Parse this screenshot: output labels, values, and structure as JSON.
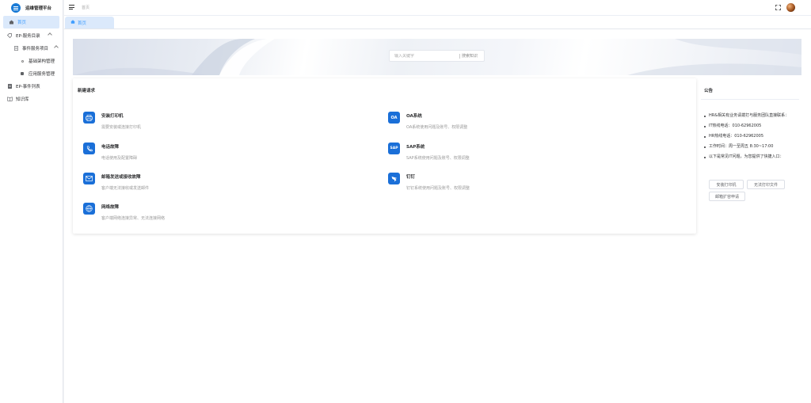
{
  "app": {
    "title": "运维管理平台"
  },
  "sidebar": {
    "items": [
      {
        "label": "首页",
        "icon": "home-icon"
      },
      {
        "label": "EP-服务目录",
        "icon": "tag-icon"
      },
      {
        "label": "事件服务项目",
        "icon": "document-icon"
      },
      {
        "label": "基础架构管理",
        "icon": "dot-icon"
      },
      {
        "label": "应用服务管理",
        "icon": "square-icon"
      },
      {
        "label": "EP-事件列表",
        "icon": "list-icon"
      },
      {
        "label": "知识库",
        "icon": "book-icon"
      }
    ]
  },
  "header": {
    "breadcrumb": "首页"
  },
  "tabs": [
    {
      "label": "首页"
    }
  ],
  "search": {
    "placeholder": "输入关键字",
    "button": "搜索知识"
  },
  "requests": {
    "title": "新建请求",
    "items": [
      {
        "name": "安装打印机",
        "desc": "需要安装或连接打印机",
        "icon": "printer-icon"
      },
      {
        "name": "OA系统",
        "desc": "OA系统使用问题及账号、权限调整",
        "icon_text": "OA"
      },
      {
        "name": "电话故障",
        "desc": "电话使用及配置障碍",
        "icon": "phone-icon"
      },
      {
        "name": "SAP系统",
        "desc": "SAP系统使用问题及账号、权限调整",
        "icon_text": "SAP"
      },
      {
        "name": "邮箱发送或接收故障",
        "desc": "客户端无法接收或发送邮件",
        "icon": "mail-icon"
      },
      {
        "name": "钉钉",
        "desc": "钉钉系统使用问题及账号、权限调整",
        "icon": "dingtalk-icon"
      },
      {
        "name": "网络故障",
        "desc": "客户端网络连接异常、无法连接网络",
        "icon": "globe-icon"
      }
    ]
  },
  "notice": {
    "title": "公告",
    "lines": [
      "HR&相关有业务请拨打与服务团队直接联系：",
      "IT热线电话：010-62962005",
      "HR热线电话：010-62962005",
      "工作时间：周一至周五 8:30~17:00",
      "以下是常见IT问题，为您提供了快捷入口："
    ],
    "quick_links": [
      "安装打印机",
      "无法打印文件",
      "邮箱扩容申请"
    ]
  },
  "colors": {
    "accent": "#409eff",
    "icon_bg": "#1a6fd8",
    "active_bg": "#dbe9fb"
  }
}
